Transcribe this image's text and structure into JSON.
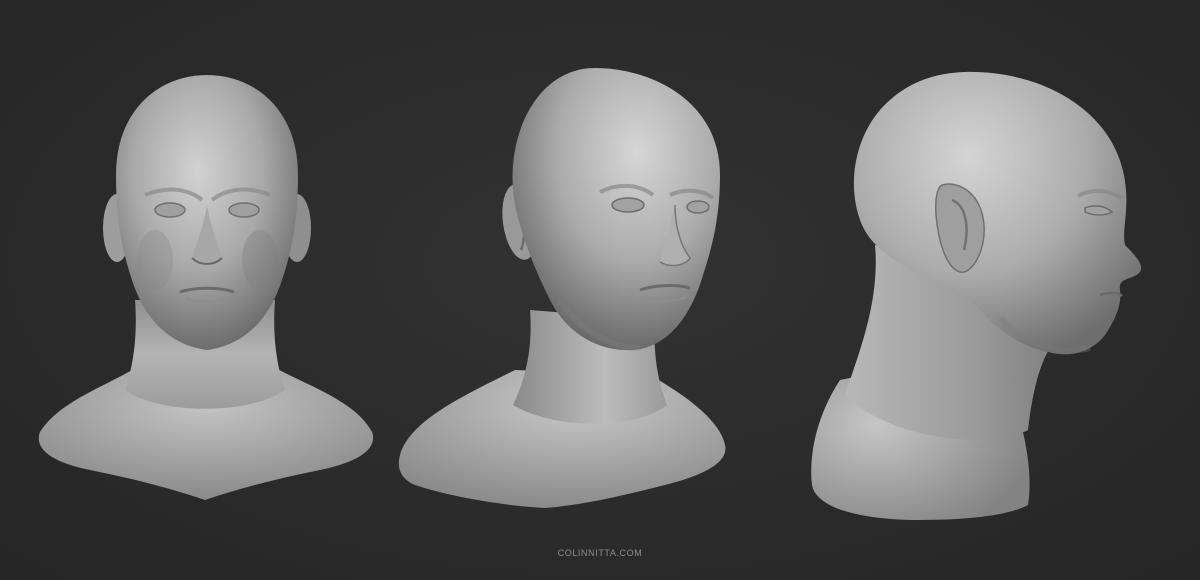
{
  "scene": {
    "background_color": "#2b2b2b",
    "material_color": "#b9b9b9",
    "views": [
      {
        "id": "front",
        "description_name": "front-view-bust"
      },
      {
        "id": "three-quarter",
        "description_name": "three-quarter-view-bust"
      },
      {
        "id": "profile",
        "description_name": "profile-view-bust"
      }
    ]
  },
  "watermark": {
    "text": "COLINNITTA.COM"
  }
}
